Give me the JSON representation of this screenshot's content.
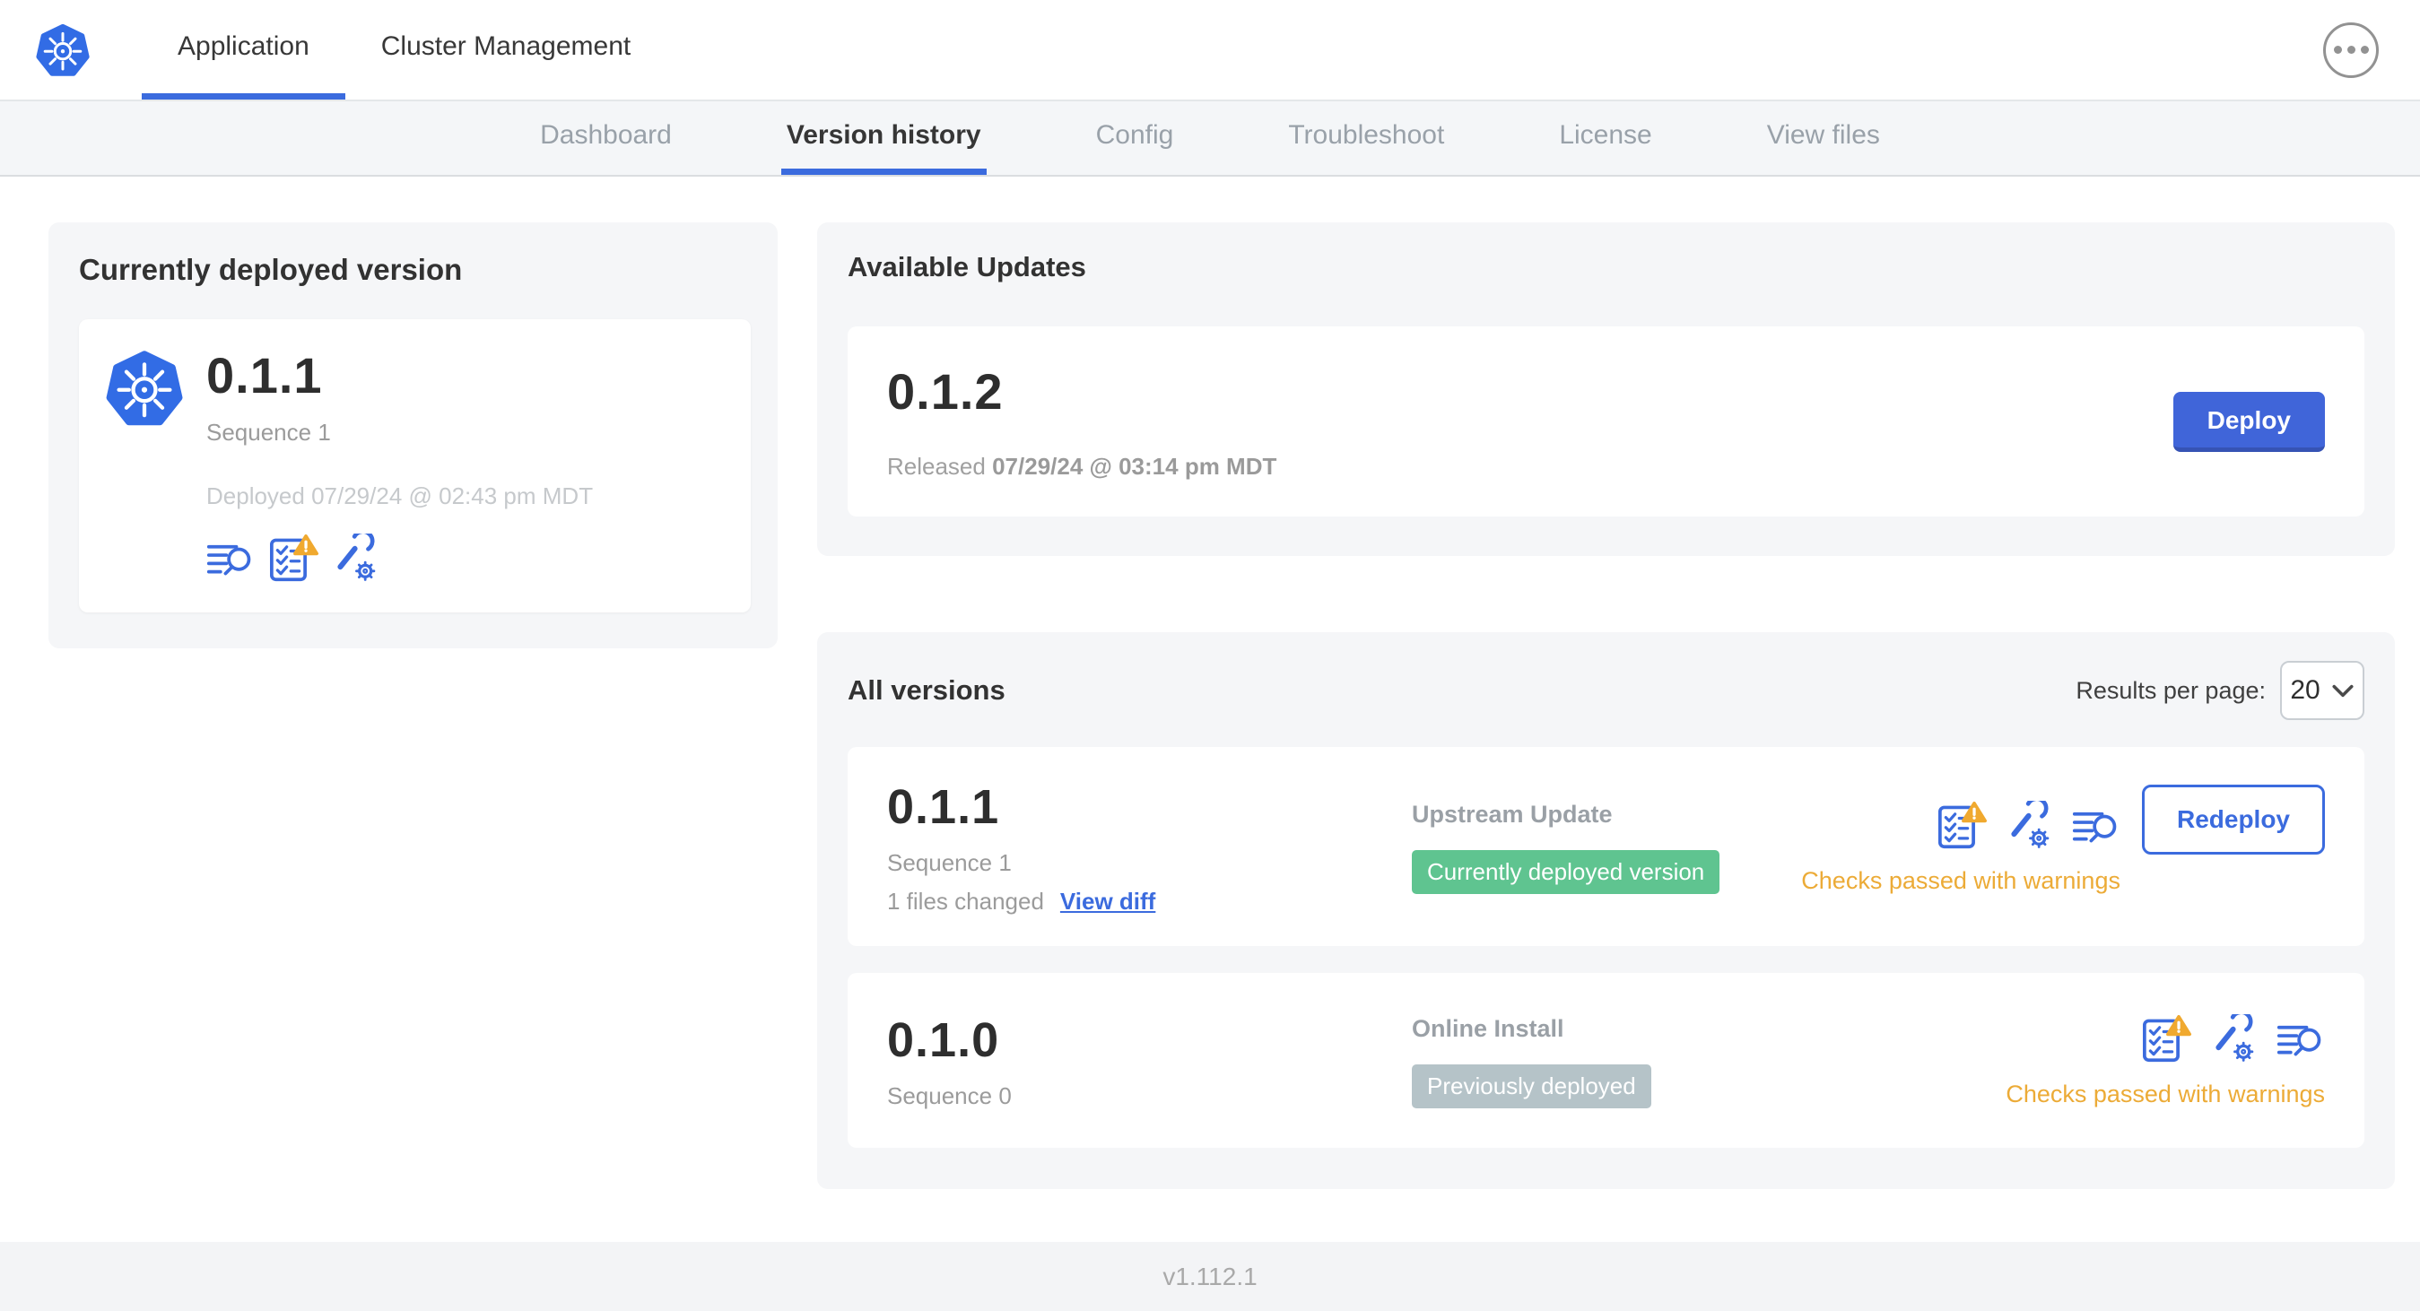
{
  "colors": {
    "accent_blue": "#3b6bde",
    "k8s_blue": "#326ce5",
    "badge_green": "#5fc490",
    "badge_gray": "#b5c3c8",
    "warning_amber": "#ecab37",
    "subnav_bg": "#f4f6f8",
    "card_bg": "#f5f6f8"
  },
  "header": {
    "logo_icon": "kubernetes-logo",
    "tabs": [
      {
        "label": "Application"
      },
      {
        "label": "Cluster Management"
      }
    ],
    "active_tab": "Application",
    "more_icon": "ellipsis-menu"
  },
  "subnav": {
    "tabs": [
      {
        "label": "Dashboard"
      },
      {
        "label": "Version history"
      },
      {
        "label": "Config"
      },
      {
        "label": "Troubleshoot"
      },
      {
        "label": "License"
      },
      {
        "label": "View files"
      }
    ],
    "active_tab": "Version history"
  },
  "deployed_card": {
    "title": "Currently deployed version",
    "app_icon": "kubernetes-logo",
    "version": "0.1.1",
    "sequence": "Sequence 1",
    "deployed_at": "Deployed 07/29/24 @ 02:43 pm MDT",
    "icons": [
      "logs-icon",
      "preflight-checks-warning-icon",
      "config-icon"
    ]
  },
  "available_updates": {
    "title": "Available Updates",
    "update": {
      "version": "0.1.2",
      "released_label": "Released",
      "released_date": "07/29/24 @ 03:14 pm MDT",
      "deploy_label": "Deploy"
    }
  },
  "all_versions": {
    "title": "All versions",
    "results_per_page_label": "Results per page:",
    "results_per_page_value": "20",
    "rows": [
      {
        "version": "0.1.1",
        "sequence": "Sequence 1",
        "files_changed": "1 files changed",
        "view_diff_label": "View diff",
        "source": "Upstream Update",
        "status_badge": "Currently deployed version",
        "status_badge_color": "#5fc490",
        "icons": [
          "preflight-checks-warning-icon",
          "config-icon",
          "logs-icon"
        ],
        "checks_status": "Checks passed with warnings",
        "action_label": "Redeploy"
      },
      {
        "version": "0.1.0",
        "sequence": "Sequence 0",
        "source": "Online Install",
        "status_badge": "Previously deployed",
        "status_badge_color": "#b5c3c8",
        "icons": [
          "preflight-checks-warning-icon",
          "config-icon",
          "logs-icon"
        ],
        "checks_status": "Checks passed with warnings"
      }
    ]
  },
  "footer": {
    "app_version": "v1.112.1"
  }
}
